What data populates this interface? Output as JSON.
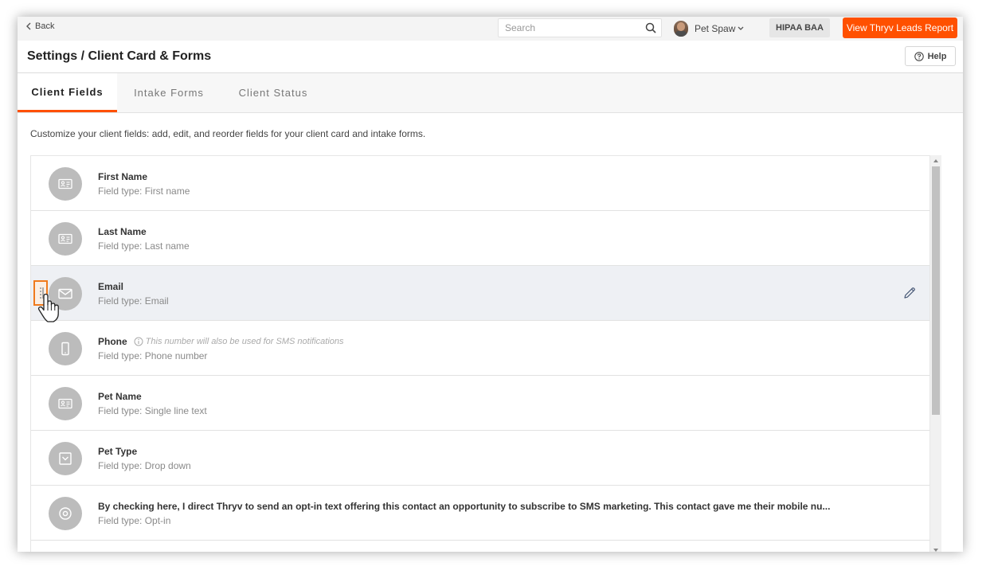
{
  "topbar": {
    "back_label": "Back",
    "search_placeholder": "Search",
    "user_name": "Pet Spaw",
    "hipaa_label": "HIPAA BAA",
    "leads_button_label": "View Thryv Leads Report"
  },
  "header": {
    "title": "Settings / Client Card & Forms",
    "help_label": "Help"
  },
  "tabs": [
    {
      "label": "Client Fields",
      "active": true
    },
    {
      "label": "Intake Forms",
      "active": false
    },
    {
      "label": "Client Status",
      "active": false
    }
  ],
  "intro_text": "Customize your client fields: add, edit, and reorder fields for your client card and intake forms.",
  "fields": [
    {
      "name": "First Name",
      "type": "Field type: First name",
      "icon": "id-card-icon"
    },
    {
      "name": "Last Name",
      "type": "Field type: Last name",
      "icon": "id-card-icon"
    },
    {
      "name": "Email",
      "type": "Field type: Email",
      "icon": "envelope-icon"
    },
    {
      "name": "Phone",
      "type": "Field type: Phone number",
      "icon": "phone-icon",
      "note": "This number will also be used for SMS notifications"
    },
    {
      "name": "Pet Name",
      "type": "Field type: Single line text",
      "icon": "id-card-icon"
    },
    {
      "name": "Pet Type",
      "type": "Field type: Drop down",
      "icon": "dropdown-icon"
    },
    {
      "name": "By checking here, I direct Thryv to send an opt-in text offering this contact an opportunity to subscribe to SMS marketing. This contact gave me their mobile nu...",
      "type": "Field type: Opt-in",
      "icon": "radio-icon"
    }
  ],
  "colors": {
    "accent": "#ff5000",
    "highlight_row": "#eef0f4",
    "icon_circle": "#bcbcbc"
  }
}
